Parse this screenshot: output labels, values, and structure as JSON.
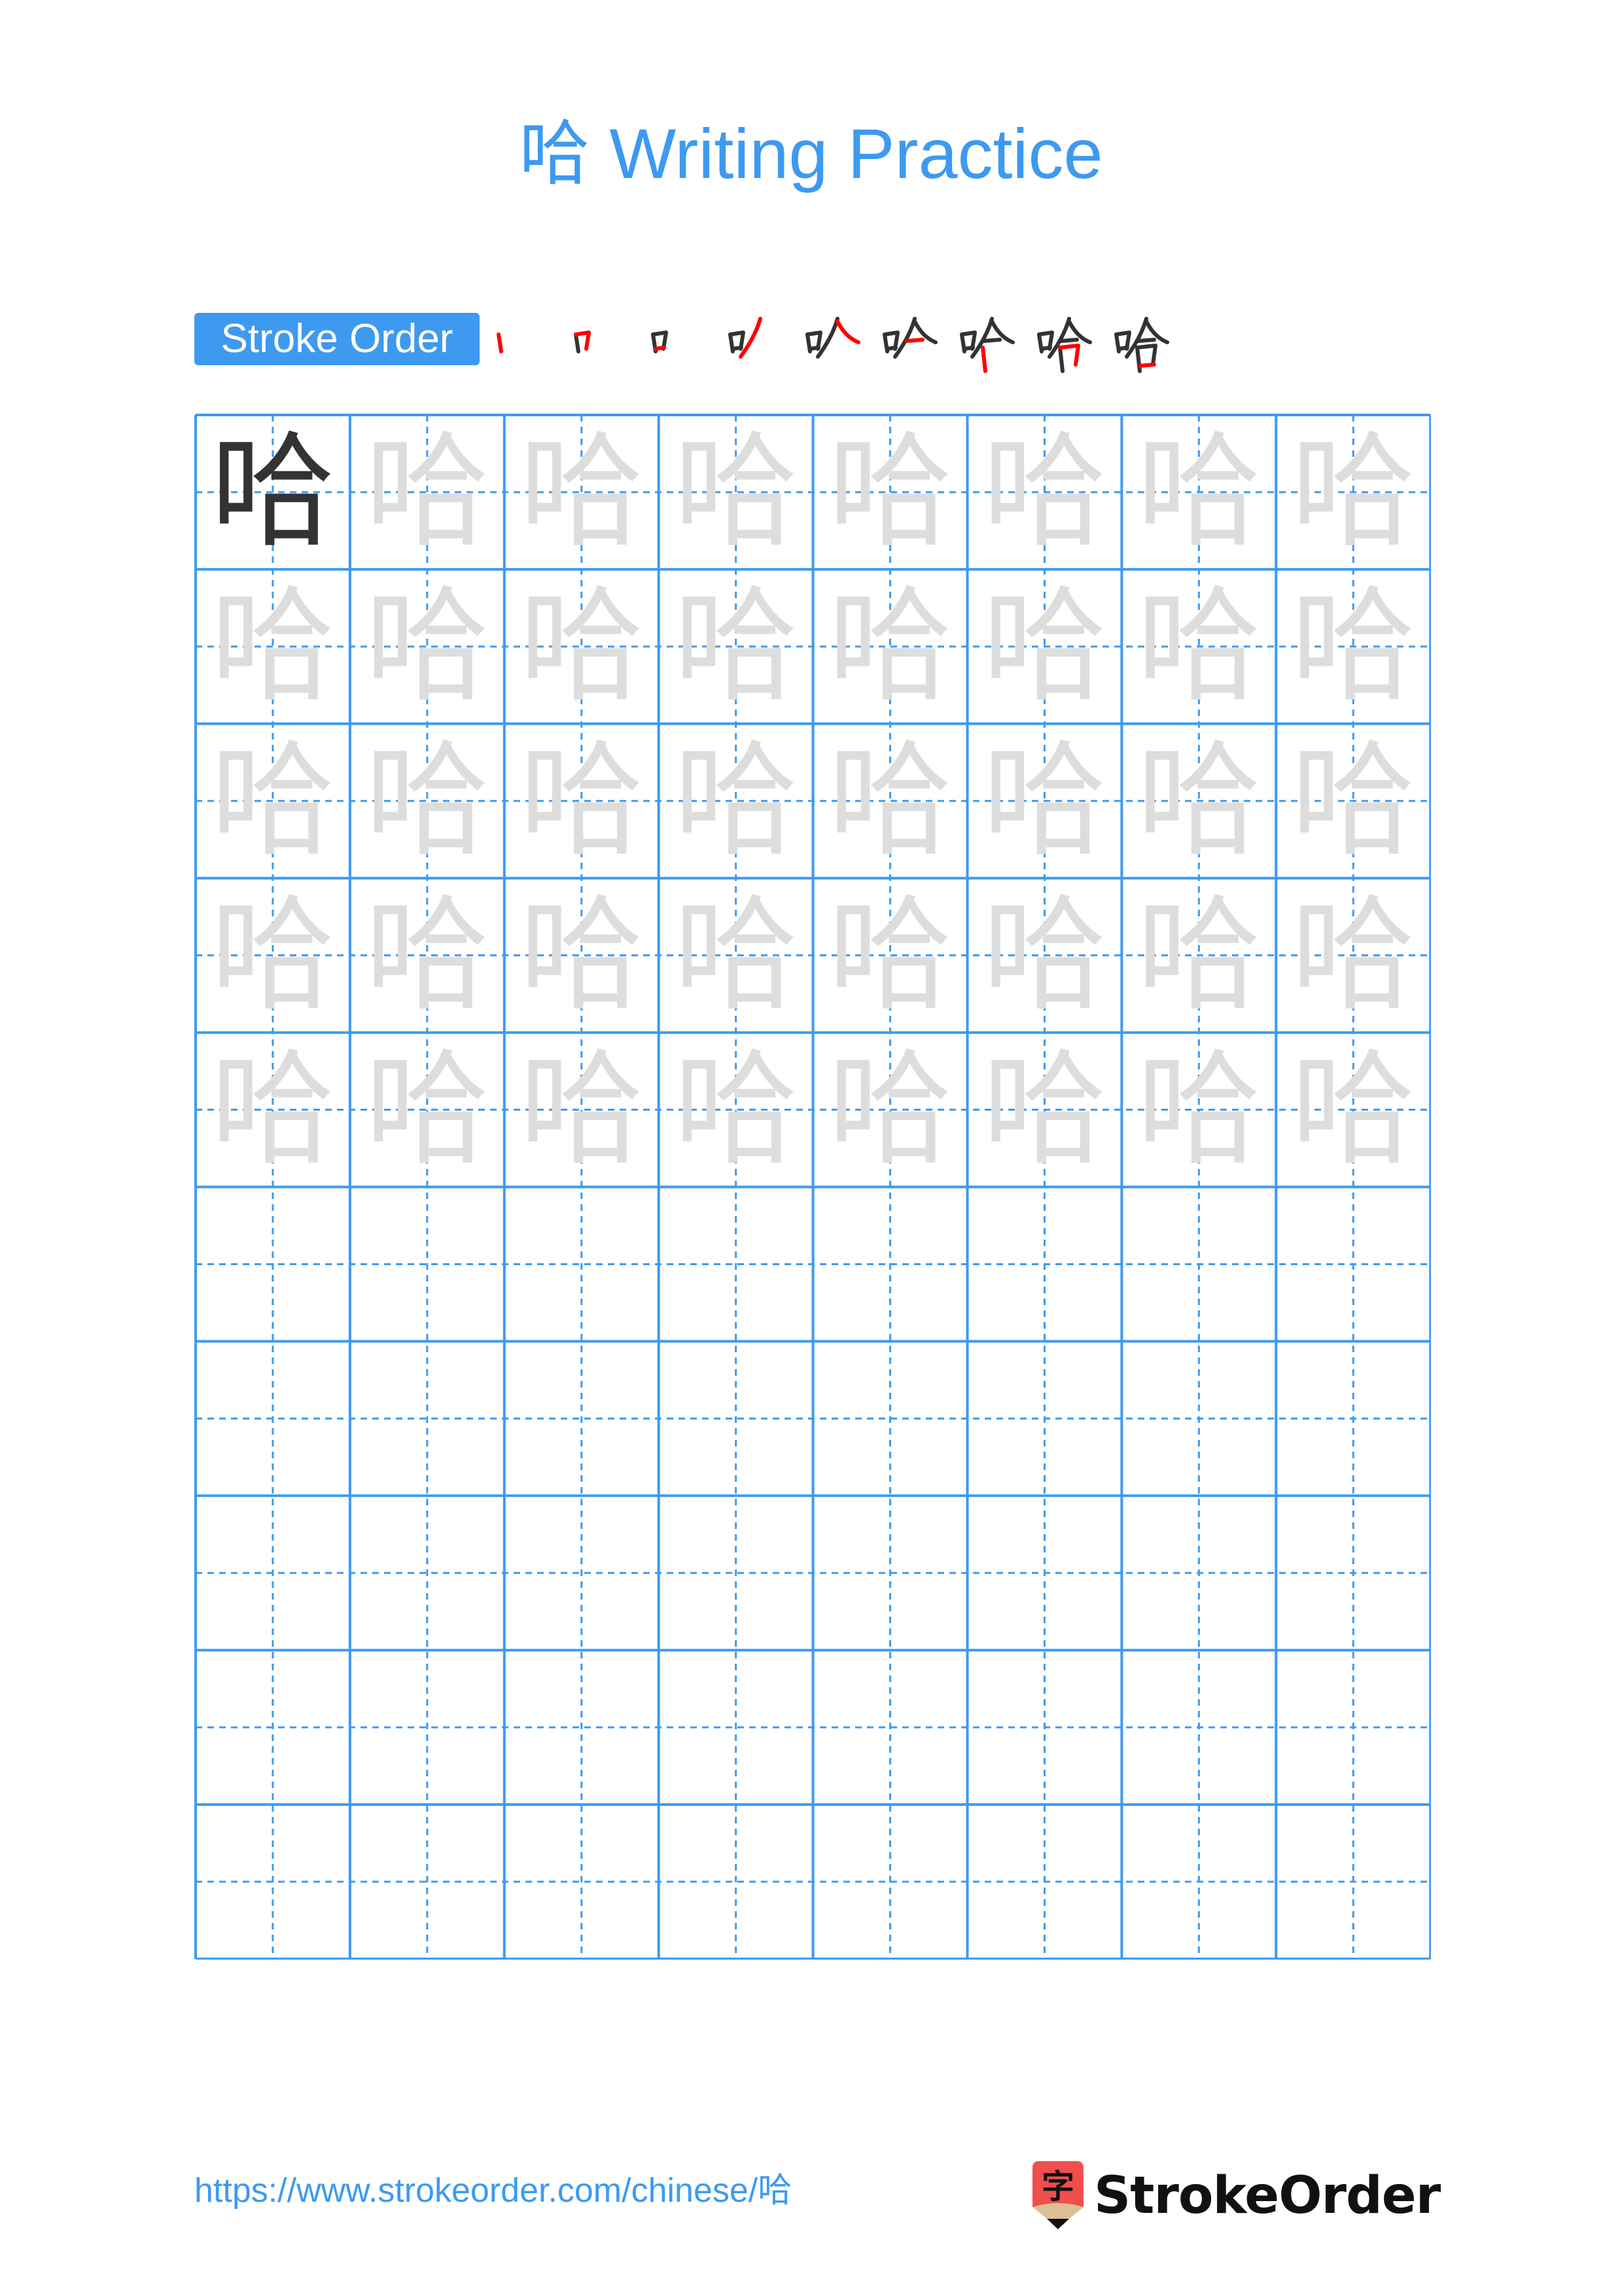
{
  "header": {
    "title": "哈 Writing Practice",
    "character": "哈"
  },
  "stroke_order": {
    "label": "Stroke Order",
    "stroke_count": 9,
    "steps": [
      {
        "index": 1,
        "description": "left vertical of 口"
      },
      {
        "index": 2,
        "description": "horizontal-turn of 口"
      },
      {
        "index": 3,
        "description": "bottom horizontal of 口"
      },
      {
        "index": 4,
        "description": "left-falling of 人"
      },
      {
        "index": 5,
        "description": "right-falling of 人"
      },
      {
        "index": 6,
        "description": "horizontal under 人"
      },
      {
        "index": 7,
        "description": "vertical of lower 口"
      },
      {
        "index": 8,
        "description": "horizontal-turn of lower 口"
      },
      {
        "index": 9,
        "description": "bottom horizontal of lower 口"
      }
    ]
  },
  "grid": {
    "columns": 8,
    "rows": 10,
    "model_character": "哈",
    "trace_rows": 5,
    "blank_rows": 5
  },
  "footer": {
    "url": "https://www.strokeorder.com/chinese/哈",
    "brand": "StrokeOrder",
    "logo_glyph": "字"
  },
  "colors": {
    "accent": "#3d9af0",
    "model_char": "#333333",
    "trace_char": "#dddddd",
    "stroke_highlight": "#ff0000",
    "logo_red": "#f04e4e",
    "logo_wood": "#dcbf94"
  }
}
